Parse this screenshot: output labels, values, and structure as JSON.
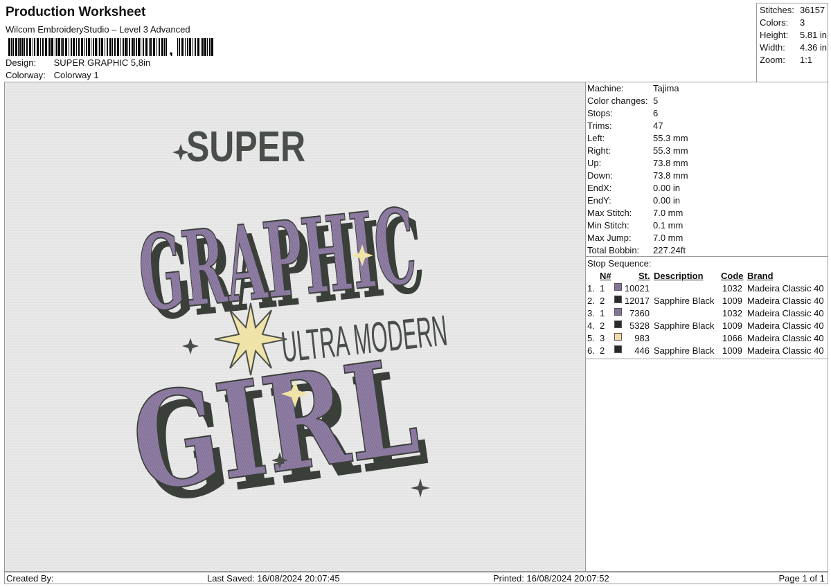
{
  "header": {
    "title": "Production Worksheet",
    "software": "Wilcom EmbroideryStudio – Level 3 Advanced",
    "design_label": "Design:",
    "design_value": "SUPER GRAPHIC 5,8in",
    "colorway_label": "Colorway:",
    "colorway_value": "Colorway 1"
  },
  "summary": [
    {
      "label": "Stitches:",
      "value": "36157"
    },
    {
      "label": "Colors:",
      "value": "3"
    },
    {
      "label": "Height:",
      "value": "5.81 in"
    },
    {
      "label": "Width:",
      "value": "4.36 in"
    },
    {
      "label": "Zoom:",
      "value": "1:1"
    }
  ],
  "artwork": {
    "word1": "SUPER",
    "word2": "GRAPHIC",
    "word3": "ULTRA MODERN",
    "word4": "GIRL",
    "colors": {
      "purple": "#86739a",
      "shadow": "#3a3f3a",
      "dark": "#4a4e4a",
      "star": "#efe3a8"
    }
  },
  "machine": [
    {
      "label": "Machine:",
      "value": "Tajima"
    },
    {
      "label": "Color changes:",
      "value": "5"
    },
    {
      "label": "Stops:",
      "value": "6"
    },
    {
      "label": "Trims:",
      "value": "47"
    },
    {
      "label": "Left:",
      "value": "55.3 mm"
    },
    {
      "label": "Right:",
      "value": "55.3 mm"
    },
    {
      "label": "Up:",
      "value": "73.8 mm"
    },
    {
      "label": "Down:",
      "value": "73.8 mm"
    },
    {
      "label": "EndX:",
      "value": "0.00 in"
    },
    {
      "label": "EndY:",
      "value": "0.00 in"
    },
    {
      "label": "Max Stitch:",
      "value": "7.0 mm"
    },
    {
      "label": "Min Stitch:",
      "value": "0.1 mm"
    },
    {
      "label": "Max Jump:",
      "value": "7.0 mm"
    },
    {
      "label": "Total Bobbin:",
      "value": "227.24ft"
    }
  ],
  "stop_sequence": {
    "label": "Stop Sequence:",
    "headers": {
      "n": "N#",
      "st": "St.",
      "description": "Description",
      "code": "Code",
      "brand": "Brand"
    },
    "rows": [
      {
        "idx": "1.",
        "n": "1",
        "color": "#86739a",
        "st": "10021",
        "description": "",
        "code": "1032",
        "brand": "Madeira Classic 40"
      },
      {
        "idx": "2.",
        "n": "2",
        "color": "#2a2a2a",
        "st": "12017",
        "description": "Sapphire Black",
        "code": "1009",
        "brand": "Madeira Classic 40"
      },
      {
        "idx": "3.",
        "n": "1",
        "color": "#86739a",
        "st": "7360",
        "description": "",
        "code": "1032",
        "brand": "Madeira Classic 40"
      },
      {
        "idx": "4.",
        "n": "2",
        "color": "#2a2a2a",
        "st": "5328",
        "description": "Sapphire Black",
        "code": "1009",
        "brand": "Madeira Classic 40"
      },
      {
        "idx": "5.",
        "n": "3",
        "color": "#f6d9a8",
        "st": "983",
        "description": "",
        "code": "1066",
        "brand": "Madeira Classic 40"
      },
      {
        "idx": "6.",
        "n": "2",
        "color": "#2a2a2a",
        "st": "446",
        "description": "Sapphire Black",
        "code": "1009",
        "brand": "Madeira Classic 40"
      }
    ]
  },
  "footer": {
    "created_by": "Created By:",
    "last_saved": "Last Saved: 16/08/2024 20:07:45",
    "printed": "Printed: 16/08/2024 20:07:52",
    "page": "Page 1 of 1"
  }
}
